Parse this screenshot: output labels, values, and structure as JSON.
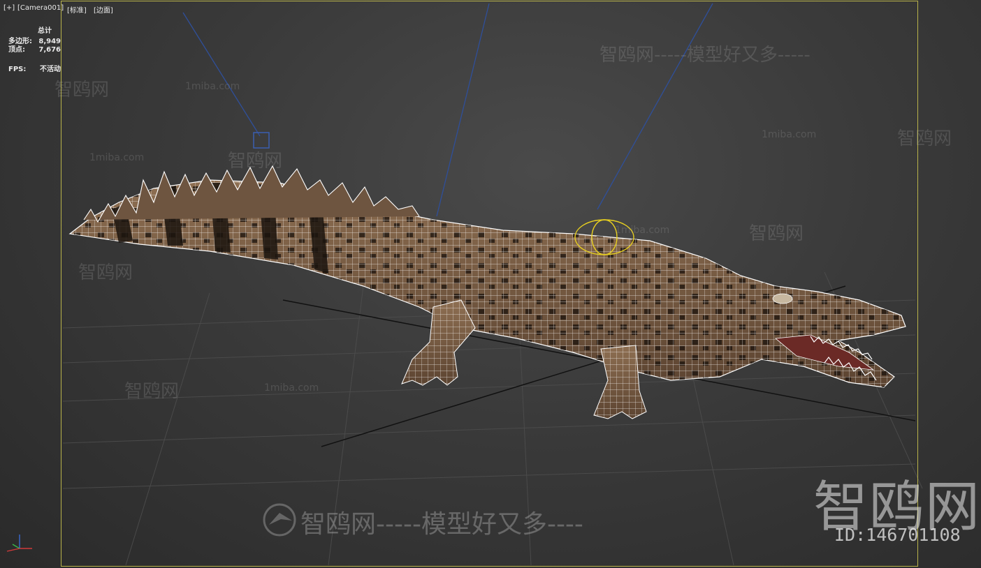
{
  "viewport": {
    "labels": {
      "plus": "[+]",
      "camera": "[Camera001]",
      "shading": "[标准]",
      "display": "[边面]"
    }
  },
  "stats": {
    "header": "总计",
    "polygons_label": "多边形:",
    "polygons_value": "8,949",
    "vertices_label": "顶点:",
    "vertices_value": "7,676",
    "fps_label": "FPS:",
    "fps_value": "不活动"
  },
  "watermarks": {
    "brand": "智鸥网",
    "site": "1miba.com",
    "slogan_line": "智鸥网-----模型好又多----",
    "slogan_line2": "智鸥网-----模型好又多-----",
    "id_text": "ID:146701108"
  },
  "colors": {
    "frame": "#b9b34a",
    "wire": "#ffffff",
    "skin": "#8a6a4e",
    "light_line": "#2f4f9a"
  },
  "icons": [
    "axis-gizmo-icon",
    "bird-logo-icon",
    "camera-target-icon",
    "light-gizmo-icon"
  ]
}
